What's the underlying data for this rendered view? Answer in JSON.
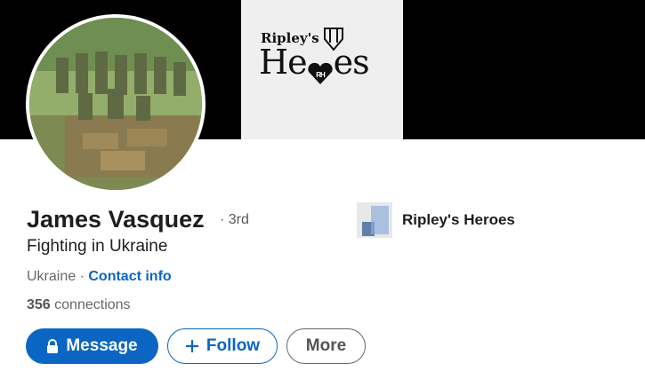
{
  "profile": {
    "name": "James Vasquez",
    "degree": "· 3rd",
    "headline": "Fighting in Ukraine",
    "location": "Ukraine",
    "separator": " · ",
    "contact_info": "Contact info",
    "connections_count": "356",
    "connections_label": " connections"
  },
  "banner": {
    "logo_small": "Ripley's",
    "logo_big_left": "He",
    "logo_big_right": "es",
    "logo_monogram": "RH"
  },
  "company": {
    "name": "Ripley's Heroes"
  },
  "actions": {
    "message": "Message",
    "follow": "Follow",
    "more": "More"
  },
  "colors": {
    "accent": "#0a66c2",
    "banner": "#000000"
  },
  "icons": {
    "message": "lock-icon",
    "follow": "plus-icon"
  }
}
